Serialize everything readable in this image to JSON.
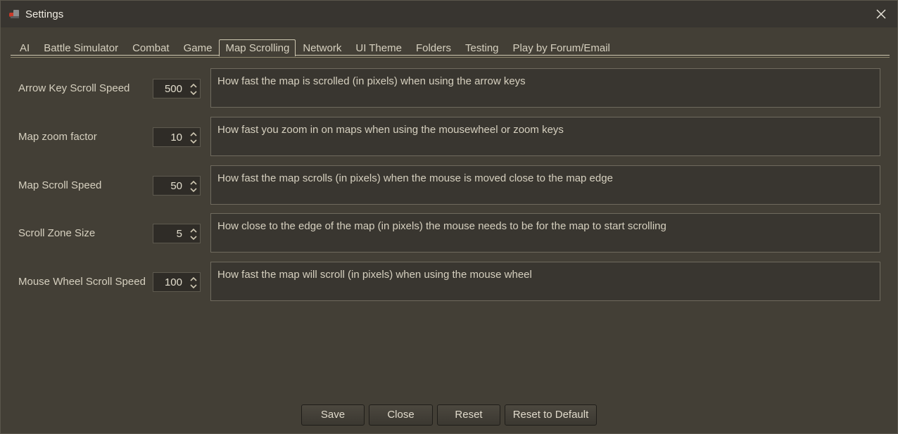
{
  "window": {
    "title": "Settings",
    "app_icon": "game-app-icon",
    "close_icon": "close-icon"
  },
  "tabs": [
    {
      "label": "AI",
      "active": false
    },
    {
      "label": "Battle Simulator",
      "active": false
    },
    {
      "label": "Combat",
      "active": false
    },
    {
      "label": "Game",
      "active": false
    },
    {
      "label": "Map Scrolling",
      "active": true
    },
    {
      "label": "Network",
      "active": false
    },
    {
      "label": "UI Theme",
      "active": false
    },
    {
      "label": "Folders",
      "active": false
    },
    {
      "label": "Testing",
      "active": false
    },
    {
      "label": "Play by Forum/Email",
      "active": false
    }
  ],
  "settings": [
    {
      "label": "Arrow Key Scroll Speed",
      "value": "500",
      "description": "How fast the map is scrolled (in pixels) when using the arrow keys"
    },
    {
      "label": "Map zoom factor",
      "value": "10",
      "description": "How fast you zoom in on maps when using the mousewheel or zoom keys"
    },
    {
      "label": "Map Scroll Speed",
      "value": "50",
      "description": "How fast the map scrolls (in pixels) when the mouse is moved close to the map edge"
    },
    {
      "label": "Scroll Zone Size",
      "value": "5",
      "description": "How close to the edge of the map (in pixels) the mouse needs to be for the map to start scrolling"
    },
    {
      "label": "Mouse Wheel Scroll Speed",
      "value": "100",
      "description": "How fast the map will scroll (in pixels) when using the mouse wheel"
    }
  ],
  "buttons": {
    "save": "Save",
    "close": "Close",
    "reset": "Reset",
    "reset_default": "Reset to Default"
  },
  "colors": {
    "background": "#433f36",
    "titlebar": "#383530",
    "text": "#d6d0bf",
    "accent_border": "#cfc8b2"
  }
}
